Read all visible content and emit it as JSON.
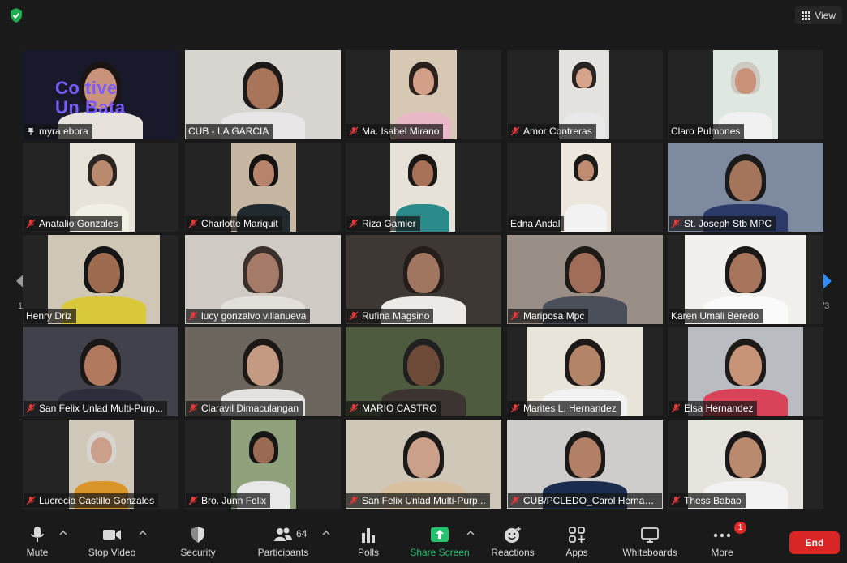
{
  "view": {
    "label": "View"
  },
  "pages": {
    "current": "1/3"
  },
  "participants": [
    {
      "name": "myra ebora",
      "mic": "pin",
      "active": true
    },
    {
      "name": "CUB - LA GARCIA",
      "mic": "none"
    },
    {
      "name": "Ma. Isabel Mirano",
      "mic": "muted"
    },
    {
      "name": "Amor Contreras",
      "mic": "muted"
    },
    {
      "name": "Claro Pulmones",
      "mic": "none"
    },
    {
      "name": "Anatalio Gonzales",
      "mic": "muted"
    },
    {
      "name": "Charlotte Mariquit",
      "mic": "muted"
    },
    {
      "name": "Riza Gamier",
      "mic": "muted"
    },
    {
      "name": "Edna Andal",
      "mic": "none"
    },
    {
      "name": "St. Joseph Stb MPC",
      "mic": "muted"
    },
    {
      "name": "Henry Driz",
      "mic": "none"
    },
    {
      "name": "lucy gonzalvo villanueva",
      "mic": "muted"
    },
    {
      "name": "Rufina Magsino",
      "mic": "muted"
    },
    {
      "name": "Mariposa Mpc",
      "mic": "muted"
    },
    {
      "name": "Karen Umali Beredo",
      "mic": "none"
    },
    {
      "name": "San Felix Unlad Multi-Purp...",
      "mic": "muted"
    },
    {
      "name": "Claravil Dimaculangan",
      "mic": "muted"
    },
    {
      "name": "MARIO CASTRO",
      "mic": "muted"
    },
    {
      "name": "Marites L. Hernandez",
      "mic": "muted"
    },
    {
      "name": "Elsa Hernandez",
      "mic": "muted"
    },
    {
      "name": "Lucrecia Castillo Gonzales",
      "mic": "muted"
    },
    {
      "name": "Bro. Junn Felix",
      "mic": "muted"
    },
    {
      "name": "San Felix Unlad Multi-Purp...",
      "mic": "muted"
    },
    {
      "name": "CUB/PCLEDO_Carol Hernan...",
      "mic": "muted"
    },
    {
      "name": "Thess Babao",
      "mic": "muted"
    }
  ],
  "background_text": {
    "line1": "Co    tive",
    "line2": "Un    Bata"
  },
  "toolbar": {
    "mute": "Mute",
    "stop_video": "Stop Video",
    "security": "Security",
    "participants": "Participants",
    "participants_count": "64",
    "polls": "Polls",
    "share_screen": "Share Screen",
    "reactions": "Reactions",
    "apps": "Apps",
    "whiteboards": "Whiteboards",
    "more": "More",
    "more_badge": "1",
    "end": "End"
  },
  "colors": {
    "accent_green": "#25c16f",
    "end_red": "#d92525",
    "active_border": "#e5e57a",
    "nav_blue": "#2d8cff"
  }
}
